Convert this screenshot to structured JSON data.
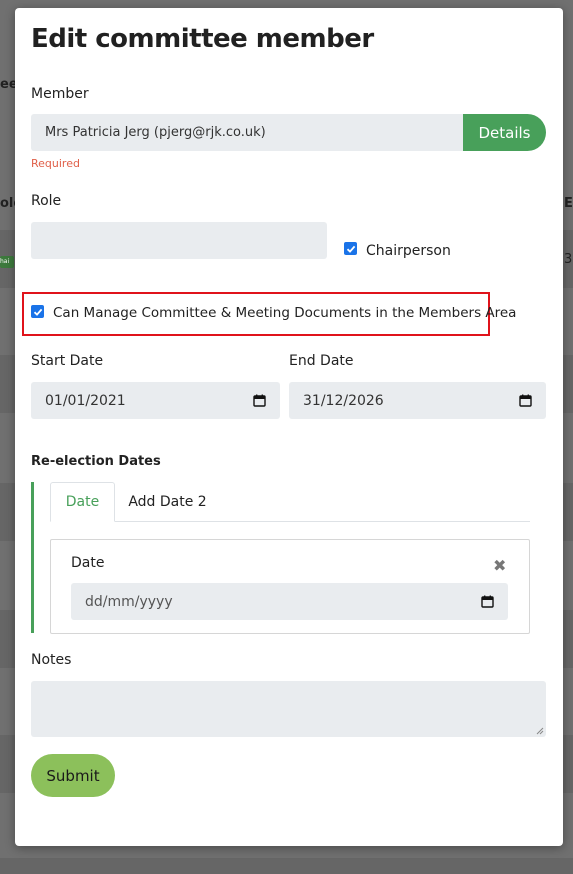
{
  "background": {
    "fragment_1": "eet",
    "fragment_2": "ole",
    "fragment_3": "E",
    "fragment_4": "3",
    "badge_text": "hai"
  },
  "modal": {
    "title": "Edit committee member",
    "member": {
      "label": "Member",
      "value": "Mrs Patricia Jerg (pjerg@rjk.co.uk)",
      "details_label": "Details",
      "required_text": "Required"
    },
    "role": {
      "label": "Role",
      "value": "",
      "chairperson_label": "Chairperson",
      "chairperson_checked": true
    },
    "manage_docs": {
      "label": "Can Manage Committee & Meeting Documents in the Members Area",
      "checked": true
    },
    "start_date": {
      "label": "Start Date",
      "value": "01/01/2021"
    },
    "end_date": {
      "label": "End Date",
      "value": "31/12/2026"
    },
    "reelection": {
      "title": "Re-election Dates",
      "tabs": [
        {
          "label": "Date",
          "active": true
        },
        {
          "label": "Add Date 2",
          "active": false
        }
      ],
      "date_label": "Date",
      "date_placeholder": "dd/mm/yyyy"
    },
    "notes": {
      "label": "Notes",
      "value": ""
    },
    "submit_label": "Submit"
  },
  "colors": {
    "accent_green": "#48a05a",
    "submit_green": "#8cc05b",
    "highlight_red": "#e0131b",
    "required_red": "#e0604a",
    "checkbox_blue": "#1a73e8"
  }
}
